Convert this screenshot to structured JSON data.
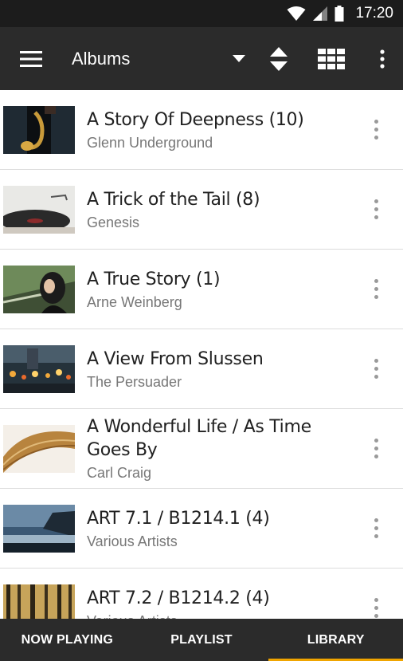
{
  "status_bar": {
    "time": "17:20"
  },
  "app_bar": {
    "title": "Albums",
    "icons": [
      "menu-icon",
      "dropdown-arrow-icon",
      "sort-icon",
      "grid-view-icon",
      "overflow-menu-icon"
    ]
  },
  "albums": [
    {
      "title": "A Story Of Deepness (10)",
      "artist": "Glenn Underground",
      "thumb": "saxophone-player"
    },
    {
      "title": "A Trick of the Tail (8)",
      "artist": "Genesis",
      "thumb": "turntable"
    },
    {
      "title": "A True Story (1)",
      "artist": "Arne Weinberg",
      "thumb": "woman-portrait"
    },
    {
      "title": "A View From Slussen",
      "artist": "The Persuader",
      "thumb": "city-lights"
    },
    {
      "title": "A Wonderful Life / As Time Goes By",
      "artist": "Carl Craig",
      "thumb": "wood-curve"
    },
    {
      "title": "ART 7.1 / B1214.1 (4)",
      "artist": "Various Artists",
      "thumb": "seaside-cliffs"
    },
    {
      "title": "ART 7.2 / B1214.2 (4)",
      "artist": "Various Artists",
      "thumb": "forest"
    }
  ],
  "bottom_nav": {
    "tabs": [
      {
        "label": "NOW PLAYING",
        "active": false
      },
      {
        "label": "PLAYLIST",
        "active": false
      },
      {
        "label": "LIBRARY",
        "active": true
      }
    ]
  },
  "colors": {
    "app_bar": "#2b2b2b",
    "status_bar": "#1c1c1c",
    "active_tab_indicator": "#f0a500",
    "title_text": "#212121",
    "subtitle_text": "#777777"
  }
}
